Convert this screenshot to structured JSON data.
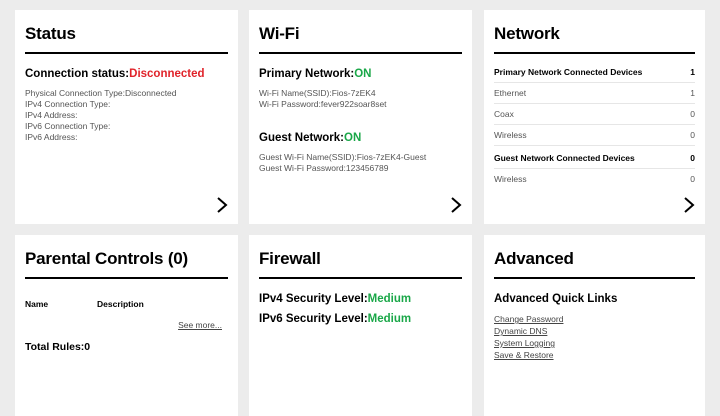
{
  "status": {
    "title": "Status",
    "conn_label": "Connection status:",
    "conn_value": "Disconnected",
    "lines": [
      "Physical Connection Type:Disconnected",
      "IPv4 Connection Type:",
      "IPv4 Address:",
      "IPv6 Connection Type:",
      "IPv6 Address:"
    ]
  },
  "wifi": {
    "title": "Wi-Fi",
    "primary_label": "Primary Network:",
    "primary_value": "ON",
    "primary_lines": [
      "Wi-Fi Name(SSID):Fios-7zEK4",
      "Wi-Fi Password:fever922soar8set"
    ],
    "guest_label": "Guest Network:",
    "guest_value": "ON",
    "guest_lines": [
      "Guest Wi-Fi Name(SSID):Fios-7zEK4-Guest",
      "Guest Wi-Fi Password:123456789"
    ]
  },
  "network": {
    "title": "Network",
    "primary_head": "Primary Network Connected Devices",
    "primary_count": "1",
    "primary_rows": [
      {
        "label": "Ethernet",
        "count": "1"
      },
      {
        "label": "Coax",
        "count": "0"
      },
      {
        "label": "Wireless",
        "count": "0"
      }
    ],
    "guest_head": "Guest Network Connected Devices",
    "guest_count": "0",
    "guest_rows": [
      {
        "label": "Wireless",
        "count": "0"
      }
    ]
  },
  "parental": {
    "title": "Parental Controls (0)",
    "col_name": "Name",
    "col_desc": "Description",
    "see_more": "See more...",
    "total": "Total Rules:0"
  },
  "firewall": {
    "title": "Firewall",
    "ipv4_label": "IPv4 Security Level:",
    "ipv4_value": "Medium",
    "ipv6_label": "IPv6 Security Level:",
    "ipv6_value": "Medium"
  },
  "advanced": {
    "title": "Advanced",
    "quick_links_title": "Advanced Quick Links",
    "links": [
      "Change Password",
      "Dynamic DNS",
      "System Logging",
      "Save & Restore"
    ]
  },
  "icons": {
    "chevron": "chevron-right-icon"
  },
  "colors": {
    "disconnected": "#e0232a",
    "on": "#1aa748",
    "background": "#ececec"
  }
}
